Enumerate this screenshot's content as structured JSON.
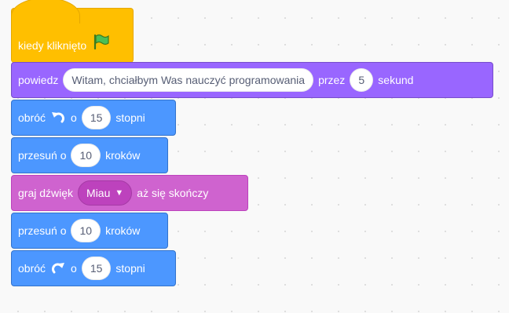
{
  "script": {
    "hat": {
      "label": "kiedy kliknięto",
      "flag_icon": "green-flag-icon",
      "color": "#ffbf00"
    },
    "say": {
      "label1": "powiedz",
      "message": "Witam, chciałbym Was nauczyć programowania",
      "label2": "przez",
      "seconds": "5",
      "label3": "sekund",
      "color": "#9966ff"
    },
    "turn1": {
      "label1": "obróć",
      "icon": "rotate-left-icon",
      "label2": "o",
      "degrees": "15",
      "label3": "stopni",
      "color": "#4c97ff"
    },
    "move1": {
      "label1": "przesuń o",
      "steps": "10",
      "label2": "kroków"
    },
    "sound": {
      "label1": "graj dźwięk",
      "sound_name": "Miau",
      "label2": "aż się skończy",
      "color": "#cf63cf"
    },
    "move2": {
      "label1": "przesuń o",
      "steps": "10",
      "label2": "kroków"
    },
    "turn2": {
      "label1": "obróć",
      "icon": "rotate-right-icon",
      "label2": "o",
      "degrees": "15",
      "label3": "stopni"
    }
  }
}
